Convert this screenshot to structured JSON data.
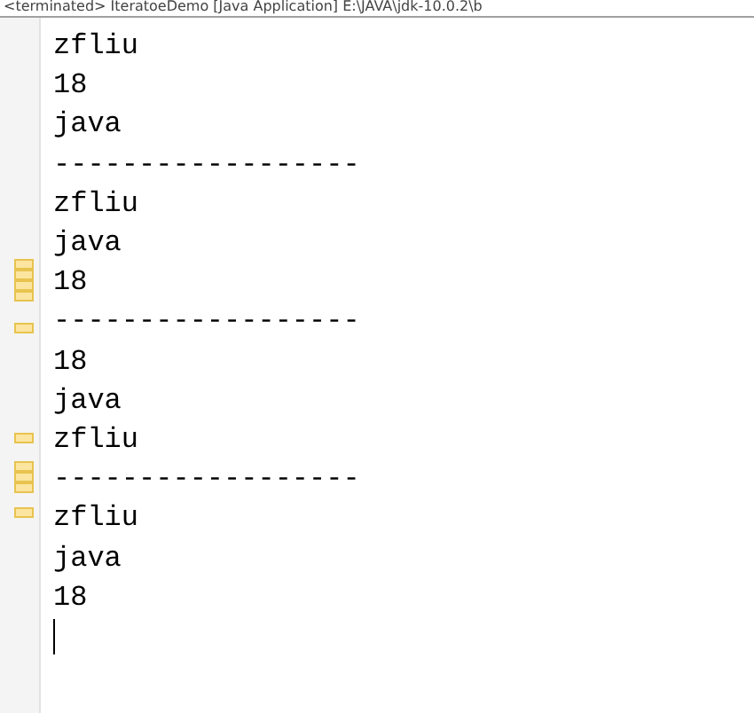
{
  "console": {
    "title": "<terminated> IteratoeDemo [Java Application] E:\\JAVA\\jdk-10.0.2\\b",
    "lines": [
      "zfliu",
      "18",
      "java",
      "------------------",
      "zfliu",
      "java",
      "18",
      "------------------",
      "18",
      "java",
      "zfliu",
      "------------------",
      "zfliu",
      "java",
      "18"
    ]
  }
}
